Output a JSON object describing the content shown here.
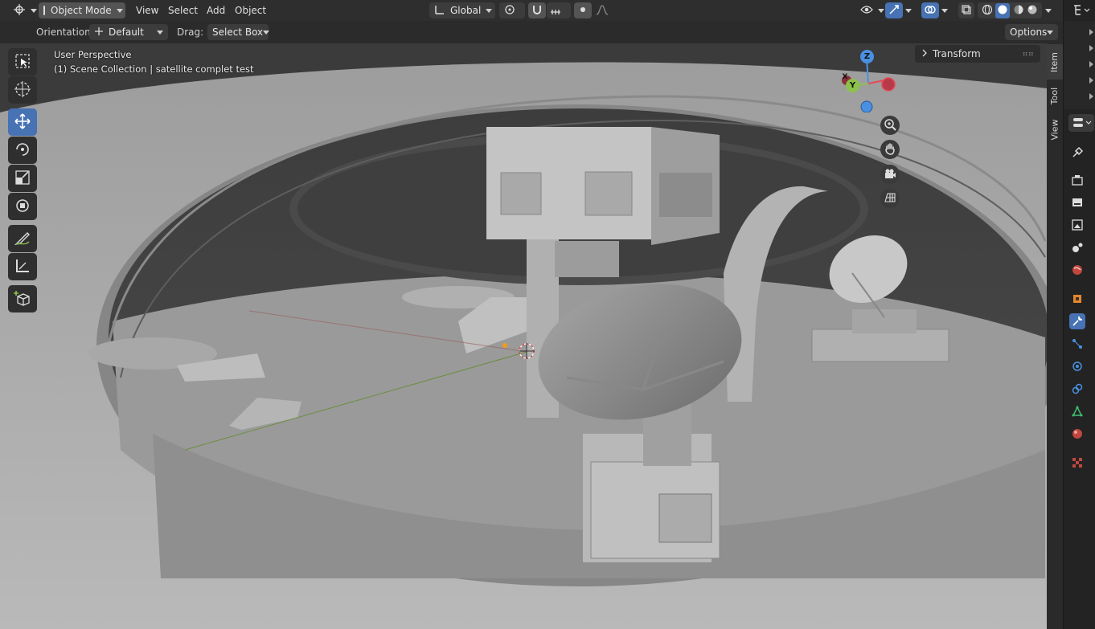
{
  "header": {
    "editor_type_icon": "view3d-editor-icon",
    "mode_label": "Object Mode",
    "menus": [
      "View",
      "Select",
      "Add",
      "Object"
    ],
    "orientation_global": "Global"
  },
  "tool_settings": {
    "orientation_label": "Orientation:",
    "orientation_value": "Default",
    "drag_label": "Drag:",
    "drag_value": "Select Box",
    "options_label": "Options"
  },
  "viewport": {
    "perspective_text": "User Perspective",
    "collection_text": "(1) Scene Collection | satellite complet test"
  },
  "gizmo": {
    "z_label": "Z",
    "y_label": "Y",
    "x_label": "X"
  },
  "npanel": {
    "transform_label": "Transform",
    "tabs": [
      "Item",
      "Tool",
      "View"
    ]
  },
  "colors": {
    "accent": "#4772b3",
    "axis_x": "#e54b5b",
    "axis_y": "#8bc34a",
    "axis_z": "#4a90e2"
  }
}
